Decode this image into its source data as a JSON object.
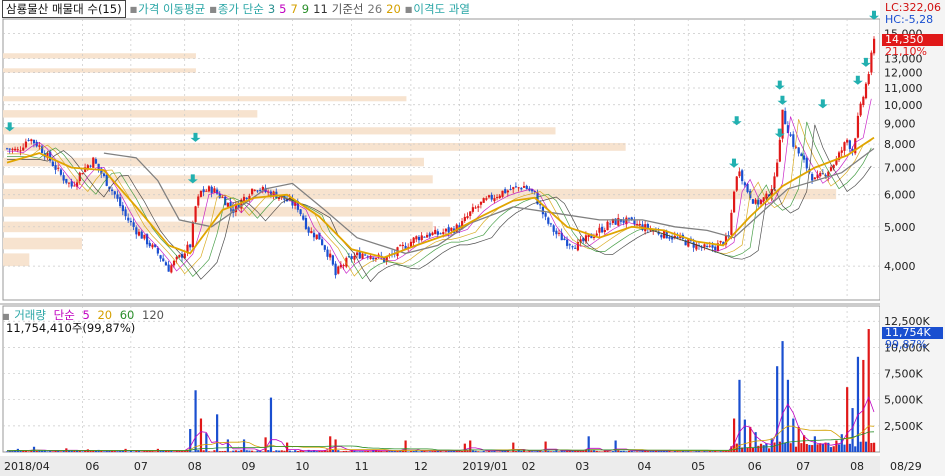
{
  "legend_top": {
    "title": "삼룡물산 매물대 수(15)",
    "ma_price_label": "가격 이동평균",
    "ma_close_label": "종가 단순",
    "ma_periods": [
      "3",
      "5",
      "7",
      "9",
      "11"
    ],
    "ma_period_colors": [
      "#2a8f8f",
      "#c000c0",
      "#d4a000",
      "#2a8f2a",
      "#333333"
    ],
    "baseline_label": "기준선",
    "baseline_periods": [
      "26",
      "20"
    ],
    "disparity_label": "이격도 과열"
  },
  "legend_volume": {
    "title": "거래량",
    "ma_label": "단순",
    "periods": [
      "5",
      "20",
      "60",
      "120"
    ],
    "period_colors": [
      "#c000c0",
      "#d4a000",
      "#2a8f2a",
      "#333333"
    ],
    "readout": "11,754,410주(99,87%)"
  },
  "price_tags": {
    "lc": "LC:322,06",
    "hc": "HC:-5,28",
    "last": "14,350",
    "pct": "21,10%"
  },
  "volume_tags": {
    "last": "11,754K",
    "pct": "99,87%"
  },
  "colors": {
    "up": "#e01818",
    "down": "#1a4fd0",
    "ma_gold": "#e0a500",
    "baseline": "#808080",
    "volume_profile": "#f7e3cf",
    "arrow": "#22b0b0",
    "grid": "#c8c8c8"
  },
  "chart_data": [
    {
      "type": "candlestick",
      "title": "삼룡물산 매물대 수(15)",
      "y_scale": "log",
      "ylim": [
        3300,
        16000
      ],
      "y_ticks": [
        4000,
        5000,
        6000,
        7000,
        8000,
        9000,
        10000,
        11000,
        12000,
        13000,
        15000
      ],
      "y_tick_labels": [
        "4,000",
        "5,000",
        "6,000",
        "7,000",
        "8,000",
        "9,000",
        "10,000",
        "11,000",
        "12,000",
        "13,000",
        "15,000"
      ],
      "x_tick_labels": [
        "2018/04",
        "06",
        "07",
        "08",
        "09",
        "10",
        "11",
        "12",
        "2019/01",
        "02",
        "03",
        "04",
        "05",
        "06",
        "07",
        "08",
        "08/29"
      ],
      "close_path": [
        [
          0,
          7800
        ],
        [
          4,
          7700
        ],
        [
          8,
          8300
        ],
        [
          12,
          7900
        ],
        [
          16,
          7300
        ],
        [
          20,
          6700
        ],
        [
          24,
          6300
        ],
        [
          28,
          6900
        ],
        [
          32,
          7300
        ],
        [
          36,
          6600
        ],
        [
          40,
          6000
        ],
        [
          44,
          5300
        ],
        [
          48,
          4900
        ],
        [
          52,
          4600
        ],
        [
          56,
          4300
        ],
        [
          60,
          3950
        ],
        [
          64,
          4200
        ],
        [
          68,
          4500
        ],
        [
          70,
          5600
        ],
        [
          72,
          6100
        ],
        [
          76,
          6200
        ],
        [
          80,
          5900
        ],
        [
          84,
          5500
        ],
        [
          88,
          5900
        ],
        [
          92,
          6300
        ],
        [
          96,
          6100
        ],
        [
          100,
          6000
        ],
        [
          104,
          5800
        ],
        [
          108,
          5600
        ],
        [
          112,
          4900
        ],
        [
          116,
          4700
        ],
        [
          120,
          4200
        ],
        [
          122,
          3800
        ],
        [
          124,
          4000
        ],
        [
          128,
          4200
        ],
        [
          132,
          4300
        ],
        [
          136,
          4250
        ],
        [
          140,
          4150
        ],
        [
          144,
          4300
        ],
        [
          148,
          4500
        ],
        [
          152,
          4700
        ],
        [
          156,
          4800
        ],
        [
          160,
          4800
        ],
        [
          164,
          4900
        ],
        [
          168,
          5000
        ],
        [
          172,
          5400
        ],
        [
          176,
          5700
        ],
        [
          180,
          5900
        ],
        [
          184,
          6100
        ],
        [
          188,
          6200
        ],
        [
          192,
          6300
        ],
        [
          196,
          6000
        ],
        [
          200,
          5200
        ],
        [
          204,
          4800
        ],
        [
          208,
          4600
        ],
        [
          212,
          4500
        ],
        [
          216,
          4700
        ],
        [
          220,
          4900
        ],
        [
          224,
          5100
        ],
        [
          228,
          5200
        ],
        [
          232,
          5100
        ],
        [
          236,
          5000
        ],
        [
          240,
          4900
        ],
        [
          244,
          4800
        ],
        [
          248,
          4700
        ],
        [
          252,
          4600
        ],
        [
          256,
          4500
        ],
        [
          260,
          4400
        ],
        [
          264,
          4500
        ],
        [
          268,
          4700
        ],
        [
          270,
          6200
        ],
        [
          272,
          7000
        ],
        [
          274,
          6300
        ],
        [
          278,
          5700
        ],
        [
          282,
          5900
        ],
        [
          285,
          6500
        ],
        [
          288,
          9500
        ],
        [
          292,
          8000
        ],
        [
          296,
          7200
        ],
        [
          300,
          6500
        ],
        [
          304,
          6800
        ],
        [
          308,
          7300
        ],
        [
          312,
          8200
        ],
        [
          314,
          7700
        ],
        [
          316,
          9200
        ],
        [
          318,
          10500
        ],
        [
          320,
          12000
        ],
        [
          322,
          14350
        ]
      ],
      "ma_gold_path": [
        [
          0,
          7200
        ],
        [
          12,
          7600
        ],
        [
          24,
          7000
        ],
        [
          36,
          6900
        ],
        [
          48,
          5600
        ],
        [
          60,
          4500
        ],
        [
          68,
          4300
        ],
        [
          80,
          5500
        ],
        [
          92,
          5900
        ],
        [
          104,
          6000
        ],
        [
          116,
          5300
        ],
        [
          128,
          4400
        ],
        [
          140,
          4200
        ],
        [
          152,
          4500
        ],
        [
          164,
          4800
        ],
        [
          176,
          5300
        ],
        [
          188,
          5800
        ],
        [
          196,
          5900
        ],
        [
          208,
          5000
        ],
        [
          220,
          4700
        ],
        [
          232,
          5000
        ],
        [
          244,
          4900
        ],
        [
          256,
          4600
        ],
        [
          266,
          4500
        ],
        [
          276,
          5300
        ],
        [
          288,
          6300
        ],
        [
          300,
          7000
        ],
        [
          312,
          7500
        ],
        [
          322,
          8300
        ]
      ],
      "baseline_path": [
        [
          36,
          7600
        ],
        [
          48,
          7400
        ],
        [
          56,
          6500
        ],
        [
          64,
          5200
        ],
        [
          76,
          5000
        ],
        [
          96,
          6200
        ],
        [
          106,
          6400
        ],
        [
          118,
          5500
        ],
        [
          130,
          4700
        ],
        [
          148,
          4300
        ],
        [
          160,
          4500
        ],
        [
          172,
          5100
        ],
        [
          188,
          5600
        ],
        [
          204,
          5400
        ],
        [
          220,
          5200
        ],
        [
          236,
          5200
        ],
        [
          248,
          5000
        ],
        [
          260,
          4900
        ],
        [
          270,
          4700
        ],
        [
          290,
          6200
        ],
        [
          310,
          6800
        ],
        [
          322,
          7800
        ]
      ],
      "volume_profile": [
        {
          "price_low": 13000,
          "price_high": 13400,
          "extent": 0.22
        },
        {
          "price_low": 12000,
          "price_high": 12300,
          "extent": 0.22
        },
        {
          "price_low": 10200,
          "price_high": 10500,
          "extent": 0.46
        },
        {
          "price_low": 9300,
          "price_high": 9700,
          "extent": 0.29
        },
        {
          "price_low": 8450,
          "price_high": 8800,
          "extent": 0.63
        },
        {
          "price_low": 7700,
          "price_high": 8050,
          "extent": 0.71
        },
        {
          "price_low": 7050,
          "price_high": 7400,
          "extent": 0.48
        },
        {
          "price_low": 6400,
          "price_high": 6700,
          "extent": 0.49
        },
        {
          "price_low": 5850,
          "price_high": 6200,
          "extent": 0.95
        },
        {
          "price_low": 5300,
          "price_high": 5600,
          "extent": 0.51
        },
        {
          "price_low": 4850,
          "price_high": 5150,
          "extent": 0.49
        },
        {
          "price_low": 4400,
          "price_high": 4700,
          "extent": 0.09
        },
        {
          "price_low": 4000,
          "price_high": 4300,
          "extent": 0.03
        }
      ],
      "arrow_markers": [
        {
          "bar": 1,
          "price": 8600
        },
        {
          "bar": 70,
          "price": 8100
        },
        {
          "bar": 69,
          "price": 6400
        },
        {
          "bar": 271,
          "price": 8900
        },
        {
          "bar": 270,
          "price": 7000
        },
        {
          "bar": 287,
          "price": 10900
        },
        {
          "bar": 288,
          "price": 10000
        },
        {
          "bar": 287,
          "price": 8300
        },
        {
          "bar": 303,
          "price": 9800
        },
        {
          "bar": 316,
          "price": 11200
        },
        {
          "bar": 319,
          "price": 12400
        },
        {
          "bar": 322,
          "price": 16200
        }
      ]
    },
    {
      "type": "bar",
      "title": "거래량",
      "ylim": [
        0,
        13000
      ],
      "y_ticks": [
        2500,
        5000,
        7500,
        10000,
        12500
      ],
      "y_tick_labels": [
        "2,500K",
        "5,000K",
        "7,500K",
        "10,000K",
        "12,500K"
      ],
      "spikes_k": [
        [
          4,
          300
        ],
        [
          10,
          500
        ],
        [
          22,
          350
        ],
        [
          30,
          250
        ],
        [
          44,
          300
        ],
        [
          56,
          300
        ],
        [
          68,
          2200
        ],
        [
          70,
          5900
        ],
        [
          72,
          3200
        ],
        [
          74,
          1800
        ],
        [
          78,
          3600
        ],
        [
          82,
          1200
        ],
        [
          88,
          1200
        ],
        [
          96,
          1400
        ],
        [
          98,
          5200
        ],
        [
          104,
          900
        ],
        [
          120,
          1500
        ],
        [
          122,
          1200
        ],
        [
          148,
          1100
        ],
        [
          170,
          800
        ],
        [
          172,
          1100
        ],
        [
          188,
          900
        ],
        [
          200,
          1000
        ],
        [
          216,
          1500
        ],
        [
          226,
          1100
        ],
        [
          270,
          3200
        ],
        [
          272,
          6900
        ],
        [
          274,
          3100
        ],
        [
          276,
          2400
        ],
        [
          278,
          1900
        ],
        [
          284,
          1300
        ],
        [
          286,
          8200
        ],
        [
          288,
          10600
        ],
        [
          290,
          6900
        ],
        [
          292,
          3200
        ],
        [
          294,
          2400
        ],
        [
          296,
          1600
        ],
        [
          300,
          1500
        ],
        [
          304,
          900
        ],
        [
          308,
          1100
        ],
        [
          310,
          1700
        ],
        [
          312,
          6200
        ],
        [
          314,
          4200
        ],
        [
          316,
          9100
        ],
        [
          318,
          8800
        ],
        [
          320,
          11754
        ]
      ]
    }
  ]
}
